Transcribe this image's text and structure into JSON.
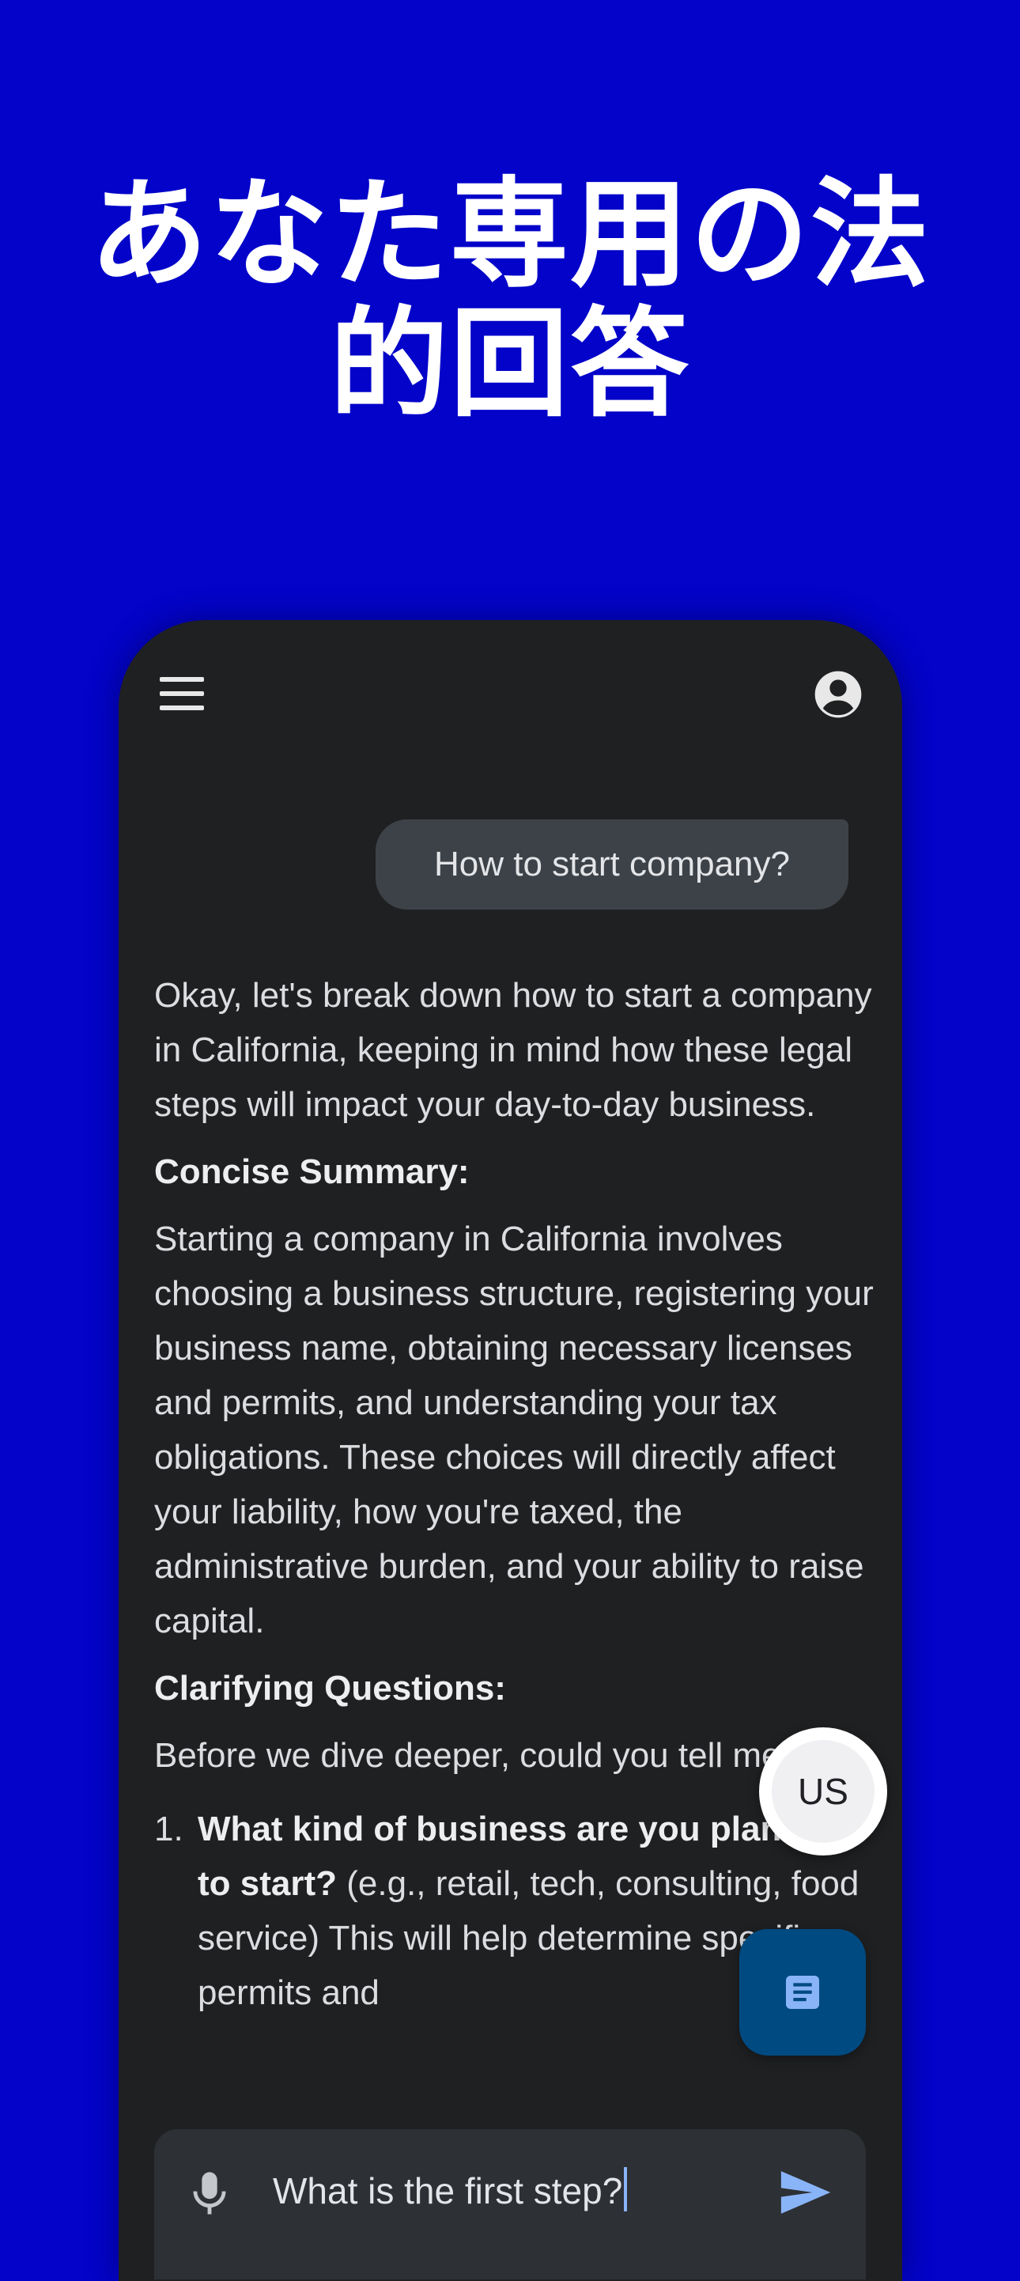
{
  "headline": {
    "line1": "あなた専用の法",
    "line2": "的回答"
  },
  "chat": {
    "user_message": "How to start company?",
    "answer": {
      "intro": "Okay, let's break down how to start a company in California, keeping in mind how these legal steps will impact your day-to-day business.",
      "summary_heading": "Concise Summary:",
      "summary_text": "Starting a company in California involves choosing a business structure, registering your business name, obtaining necessary licenses and permits, and understanding your tax obligations. These choices will directly affect your liability, how you're taxed, the administrative burden, and your ability to raise capital.",
      "questions_heading": "Clarifying Questions:",
      "questions_intro": "Before we dive deeper, could you tell me:",
      "questions": [
        {
          "number": "1.",
          "bold": "What kind of business are you planning to start?",
          "rest": " (e.g., retail, tech, consulting, food service) This will help determine specific permits and"
        }
      ]
    }
  },
  "region_button": {
    "label": "US"
  },
  "input": {
    "value": "What is the first step?"
  },
  "icons": {
    "menu": "menu-icon",
    "account": "account-circle-icon",
    "document": "document-icon",
    "mic": "mic-icon",
    "send": "send-icon"
  },
  "colors": {
    "background": "#0303c9",
    "phone_surface": "#1f2022",
    "user_bubble": "#3d4248",
    "doc_fab": "#004a82",
    "accent": "#8ab4f8"
  }
}
